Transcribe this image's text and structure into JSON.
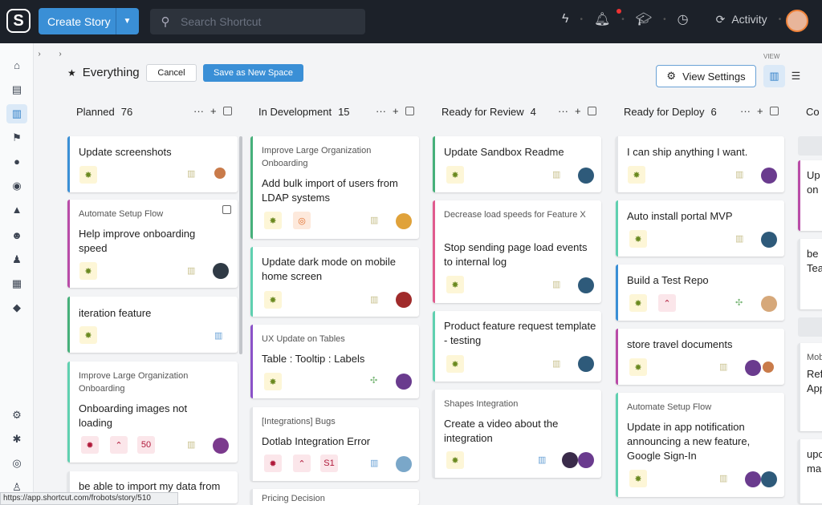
{
  "topbar": {
    "logo": "S",
    "create_label": "Create Story",
    "search_placeholder": "Search Shortcut",
    "activity_label": "Activity",
    "icons": [
      "lightning-icon",
      "bell-icon",
      "graduation-cap-icon",
      "clock-icon",
      "activity-icon"
    ]
  },
  "header": {
    "title": "Everything",
    "cancel_label": "Cancel",
    "save_label": "Save as New Space",
    "view_settings_label": "View Settings",
    "view_label": "VIEW"
  },
  "columns": [
    {
      "name": "Planned",
      "count": "76"
    },
    {
      "name": "In Development",
      "count": "15"
    },
    {
      "name": "Ready for Review",
      "count": "4"
    },
    {
      "name": "Ready for Deploy",
      "count": "6"
    },
    {
      "name": "Co",
      "count": ""
    }
  ],
  "cards": {
    "c1": {
      "title": "Update screenshots"
    },
    "c2": {
      "epic": "Automate Setup Flow",
      "title": "Help improve onboarding speed"
    },
    "c3": {
      "title": "iteration feature"
    },
    "c4": {
      "epic": "Improve Large Organization Onboarding",
      "title": "Onboarding images not loading"
    },
    "c5": {
      "title": "be able to import my data from"
    },
    "d1": {
      "epic": "Improve Large Organization Onboarding",
      "title": "Add bulk import of users from LDAP systems"
    },
    "d2": {
      "title": "Update dark mode on mobile home screen"
    },
    "d3": {
      "epic": "UX Update on Tables",
      "title": "Table : Tooltip : Labels"
    },
    "d4": {
      "epic": "[Integrations] Bugs",
      "title": "Dotlab Integration Error"
    },
    "d5": {
      "epic": "Pricing Decision"
    },
    "r1": {
      "title": "Update Sandbox Readme"
    },
    "r2": {
      "epic": "Decrease load speeds for Feature X",
      "title": "Stop sending page load events to internal log"
    },
    "r3": {
      "title": "Product feature request template - testing"
    },
    "r4": {
      "epic": "Shapes Integration",
      "title": "Create a video about the integration"
    },
    "p1": {
      "title": "I can ship anything I want."
    },
    "p2": {
      "title": "Auto install portal MVP"
    },
    "p3": {
      "title": "Build a Test Repo"
    },
    "p4": {
      "title": "store travel documents"
    },
    "p5": {
      "epic": "Automate Setup Flow",
      "title": "Update in app notification announcing a new feature, Google Sign-In"
    },
    "e1": {
      "title": "Up on"
    },
    "e2": {
      "title": "be Tea"
    },
    "e3": {
      "epic": "Mob",
      "title": "Ref App"
    },
    "e4": {
      "title": "upc ma"
    }
  },
  "tag_values": {
    "t50": "50",
    "t51": "S1"
  },
  "statusbar": "https://app.shortcut.com/frobots/story/510",
  "colors": {
    "accent": "#3a8fd6",
    "topbar": "#1c2129"
  }
}
